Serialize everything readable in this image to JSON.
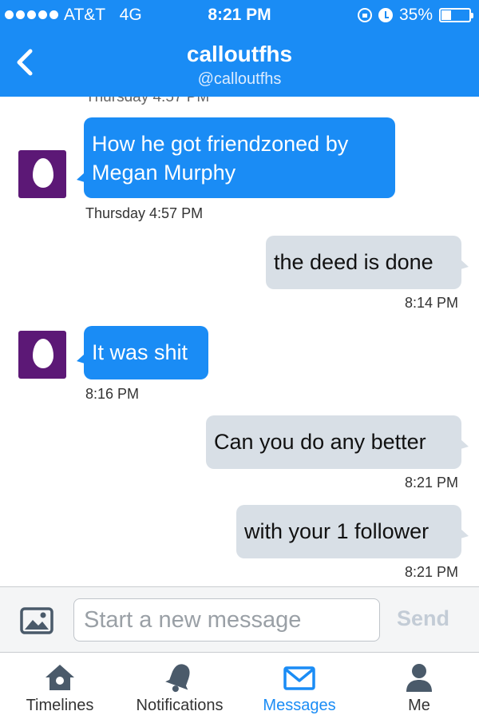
{
  "status_bar": {
    "carrier": "AT&T",
    "network": "4G",
    "time": "8:21 PM",
    "battery": "35%",
    "battery_level": 0.35
  },
  "conversation": {
    "name": "calloutfhs",
    "handle": "@calloutfhs"
  },
  "messages": {
    "cutoff_text": "Thursday 4:57 PM",
    "items": [
      {
        "direction": "incoming",
        "lines": [
          "How he got friendzoned by",
          "Megan Murphy"
        ],
        "time": "Thursday 4:57 PM"
      },
      {
        "direction": "outgoing",
        "lines": [
          "the deed is done"
        ],
        "time": "8:14 PM"
      },
      {
        "direction": "incoming",
        "lines": [
          "It was shit"
        ],
        "time": "8:16 PM"
      },
      {
        "direction": "outgoing",
        "lines": [
          "Can you do any better"
        ],
        "time": "8:21 PM"
      },
      {
        "direction": "outgoing",
        "lines": [
          "with your 1 follower"
        ],
        "time": "8:21 PM"
      }
    ]
  },
  "composer": {
    "placeholder": "Start a new message",
    "send_label": "Send"
  },
  "tabs": [
    {
      "label": "Timelines",
      "icon": "home-icon",
      "active": false
    },
    {
      "label": "Notifications",
      "icon": "bell-icon",
      "active": false
    },
    {
      "label": "Messages",
      "icon": "envelope-icon",
      "active": true
    },
    {
      "label": "Me",
      "icon": "person-icon",
      "active": false
    }
  ],
  "colors": {
    "accent": "#1a8cf5",
    "incoming_bubble": "#1a8cf5",
    "outgoing_bubble": "#d8dfe6",
    "avatar": "#5c1876"
  }
}
